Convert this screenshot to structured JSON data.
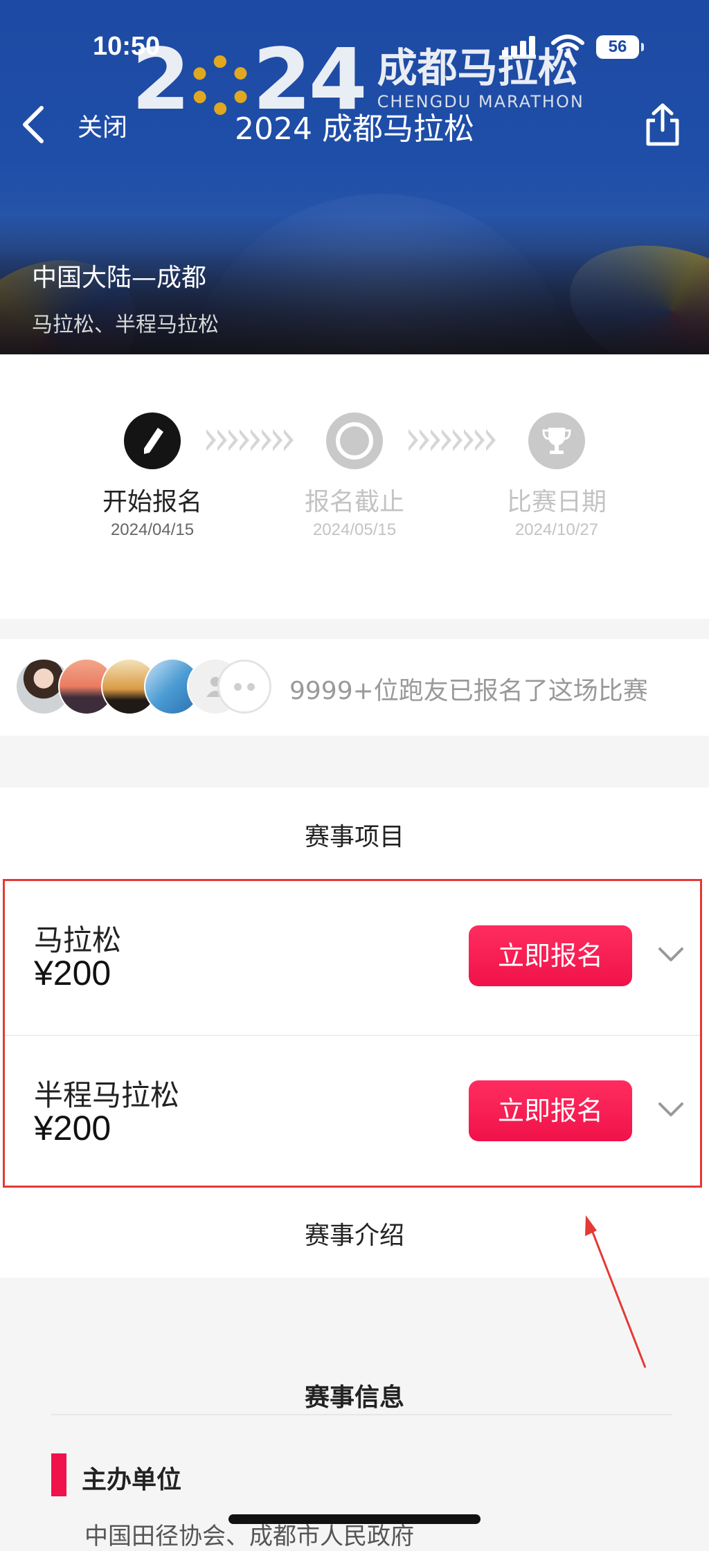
{
  "status_bar": {
    "time": "10:50",
    "battery": "56"
  },
  "hero": {
    "logo_year": "24",
    "logo_prefix": "2",
    "logo_cn": "成都马拉松",
    "logo_en": "CHENGDU MARATHON",
    "location": "中国大陆—成都",
    "event_types": "马拉松、半程马拉松"
  },
  "nav": {
    "close_label": "关闭",
    "title": "2024 成都马拉松"
  },
  "timeline": {
    "steps": [
      {
        "label": "开始报名",
        "date": "2024/04/15",
        "state": "active",
        "icon": "pen-icon"
      },
      {
        "label": "报名截止",
        "date": "2024/05/15",
        "state": "upcoming",
        "icon": "power-icon"
      },
      {
        "label": "比赛日期",
        "date": "2024/10/27",
        "state": "upcoming",
        "icon": "trophy-icon"
      }
    ]
  },
  "participants": {
    "text": "9999+位跑友已报名了这场比赛"
  },
  "events": {
    "title": "赛事项目",
    "items": [
      {
        "name": "马拉松",
        "price": "¥200",
        "button": "立即报名"
      },
      {
        "name": "半程马拉松",
        "price": "¥200",
        "button": "立即报名"
      }
    ],
    "intro_tab": "赛事介绍"
  },
  "info": {
    "title": "赛事信息",
    "organizer_title": "主办单位",
    "organizer_text": "中国田径协会、成都市人民政府"
  },
  "colors": {
    "accent": "#f0124a",
    "hero_blue": "#1f4ea8",
    "annotation_red": "#e53935"
  }
}
